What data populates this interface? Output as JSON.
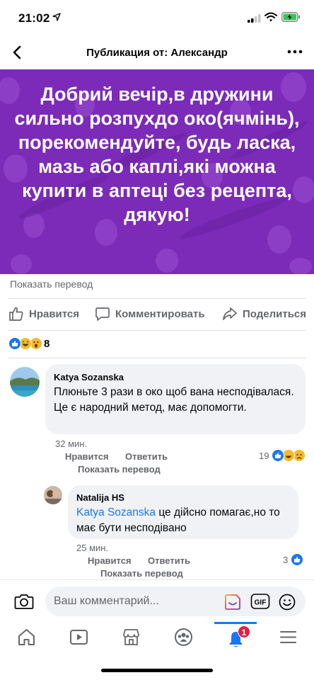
{
  "status_bar": {
    "time": "21:02"
  },
  "header": {
    "title": "Публикация от: Александр"
  },
  "post": {
    "image_text": "Добрий вечір,в дружини сильно розпухдо око(ячмінь), порекомендуйте, будь ласка, мазь або каплі,які можна купити в аптеці без рецепта, дякую!",
    "image_bg_color": "#7b2bb8",
    "translate_label": "Показать перевод"
  },
  "actions": {
    "like": "Нравится",
    "comment": "Комментировать",
    "share": "Поделиться"
  },
  "reactions": {
    "count": "8",
    "types": [
      "like",
      "haha",
      "wow"
    ]
  },
  "comments": [
    {
      "author": "Katya Sozanska",
      "text": "Плюньте 3 рази в око щоб вана несподівалася. Це є народний метод, має допомогти.",
      "time": "32 мин.",
      "like_label": "Нравится",
      "reply_label": "Ответить",
      "translate_label": "Показать перевод",
      "reaction_count": "19",
      "reaction_types": [
        "like",
        "haha",
        "sad"
      ]
    },
    {
      "author": "Natalija HS",
      "mention": "Katya Sozanska",
      "text": " це дійсно помагає,но то має бути несподівано",
      "time": "25 мин.",
      "like_label": "Нравится",
      "reply_label": "Ответить",
      "translate_label": "Показать перевод",
      "reaction_count": "3",
      "reaction_types": [
        "like"
      ]
    }
  ],
  "composer": {
    "placeholder": "Ваш комментарий...",
    "gif_label": "GIF"
  },
  "tabbar": {
    "items": [
      "home-icon",
      "video-icon",
      "marketplace-icon",
      "groups-icon",
      "notifications-icon",
      "menu-icon"
    ],
    "notifications_badge": "1",
    "accent_color": "#1877f2"
  }
}
